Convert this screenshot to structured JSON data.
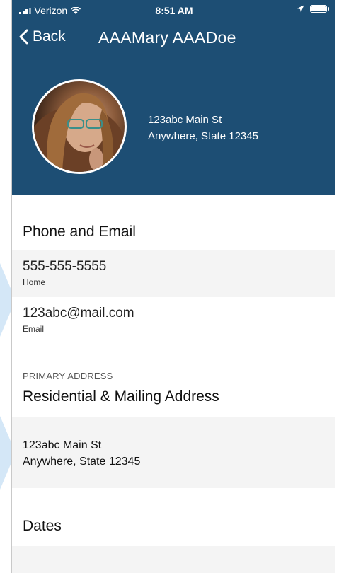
{
  "status_bar": {
    "carrier": "Verizon",
    "time": "8:51 AM"
  },
  "nav": {
    "back_label": "Back",
    "title": "AAAMary AAADoe"
  },
  "profile": {
    "address_line1": "123abc Main St",
    "address_line2": "Anywhere, State 12345"
  },
  "phone_email": {
    "heading": "Phone and Email",
    "phone": {
      "value": "555-555-5555",
      "label": "Home"
    },
    "email": {
      "value": "123abc@mail.com",
      "label": "Email"
    }
  },
  "address": {
    "caption": "PRIMARY ADDRESS",
    "heading": "Residential & Mailing Address",
    "line1": "123abc Main St",
    "line2": "Anywhere, State 12345"
  },
  "dates": {
    "heading": "Dates"
  },
  "colors": {
    "header_bg": "#1d4e74",
    "row_bg": "#f4f4f4"
  }
}
